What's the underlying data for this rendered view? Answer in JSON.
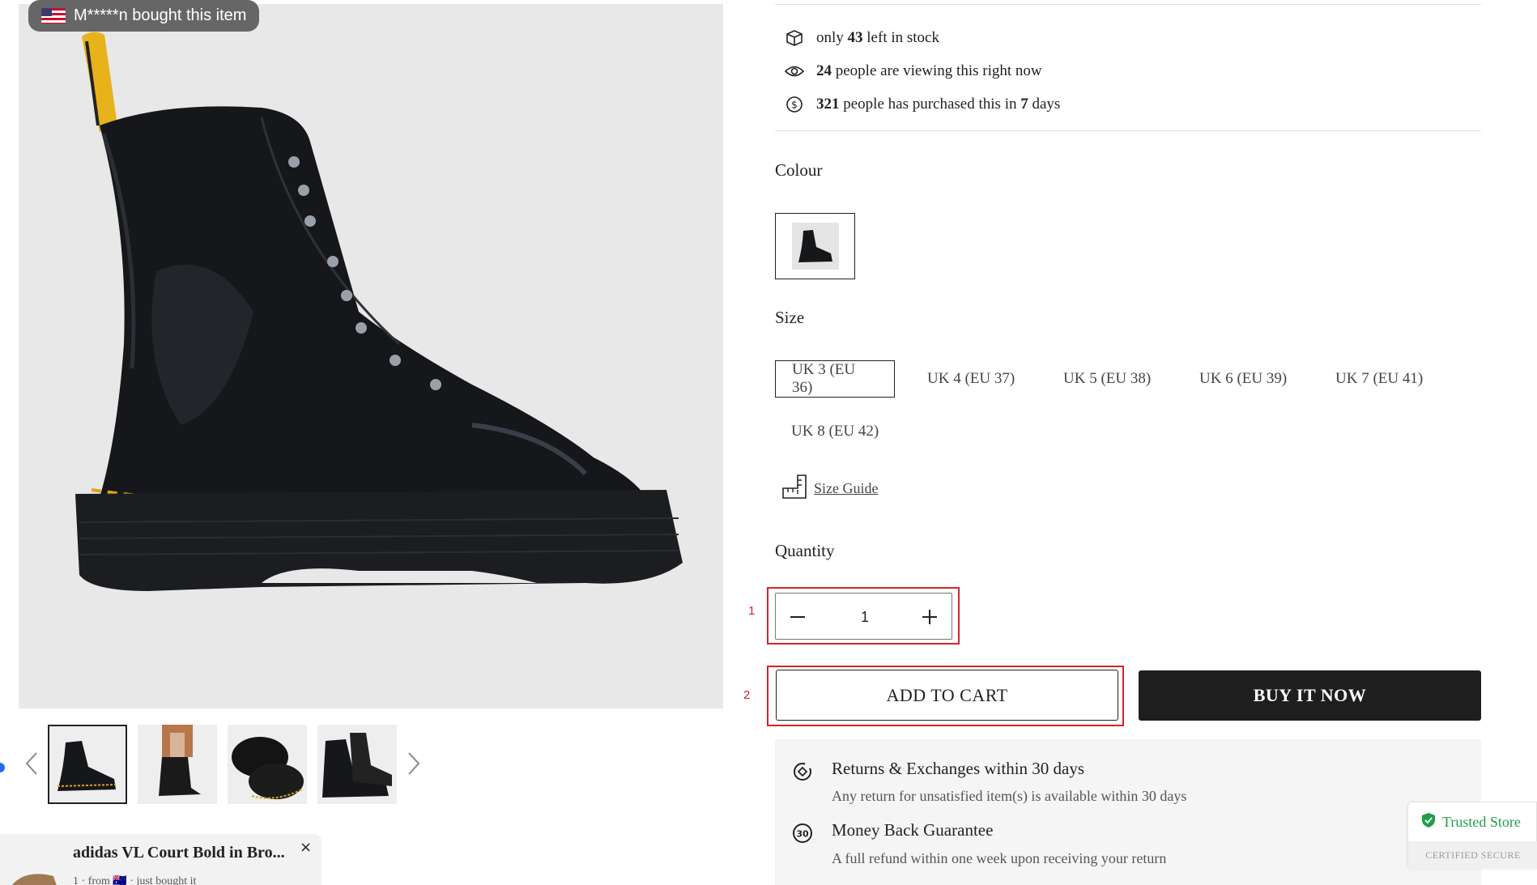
{
  "gallery": {
    "purchase_toast": "M*****n bought this item",
    "thumbnail_count": 4
  },
  "popup": {
    "title": "adidas VL Court Bold in Bro...",
    "close_label": "×",
    "subtitle": "1 · from 🇦🇺 · just bought it"
  },
  "stats": {
    "stock": {
      "prefix": "only ",
      "value": "43",
      "suffix": " left in stock"
    },
    "viewers": {
      "value": "24",
      "suffix": " people are viewing this right now"
    },
    "purchased": {
      "value": "321",
      "middle": " people has purchased this in ",
      "days": "7",
      "suffix": " days"
    }
  },
  "colour": {
    "label": "Colour"
  },
  "size": {
    "label": "Size",
    "options": [
      "UK 3 (EU 36)",
      "UK 4 (EU 37)",
      "UK 5 (EU 38)",
      "UK 6 (EU 39)",
      "UK 7 (EU 41)",
      "UK 8 (EU 42)"
    ],
    "selected": "UK 3 (EU 36)",
    "guide_label": "Size Guide"
  },
  "quantity": {
    "label": "Quantity",
    "value": "1"
  },
  "actions": {
    "add_to_cart": "ADD TO CART",
    "buy_now": "BUY IT NOW"
  },
  "annotations": {
    "marker_1": "1",
    "marker_2": "2"
  },
  "guarantees": [
    {
      "title": "Returns & Exchanges within 30 days",
      "desc": "Any return for unsatisfied item(s) is available within 30 days"
    },
    {
      "title": "Money Back Guarantee",
      "desc": "A full refund within one week upon receiving your return"
    }
  ],
  "trust_badge": {
    "title": "Trusted Store",
    "subtitle": "CERTIFIED SECURE"
  },
  "colors": {
    "buy_now_bg": "#1e1e1e",
    "trusted_green": "#1f9e4a",
    "marker_red": "#d8232a"
  }
}
